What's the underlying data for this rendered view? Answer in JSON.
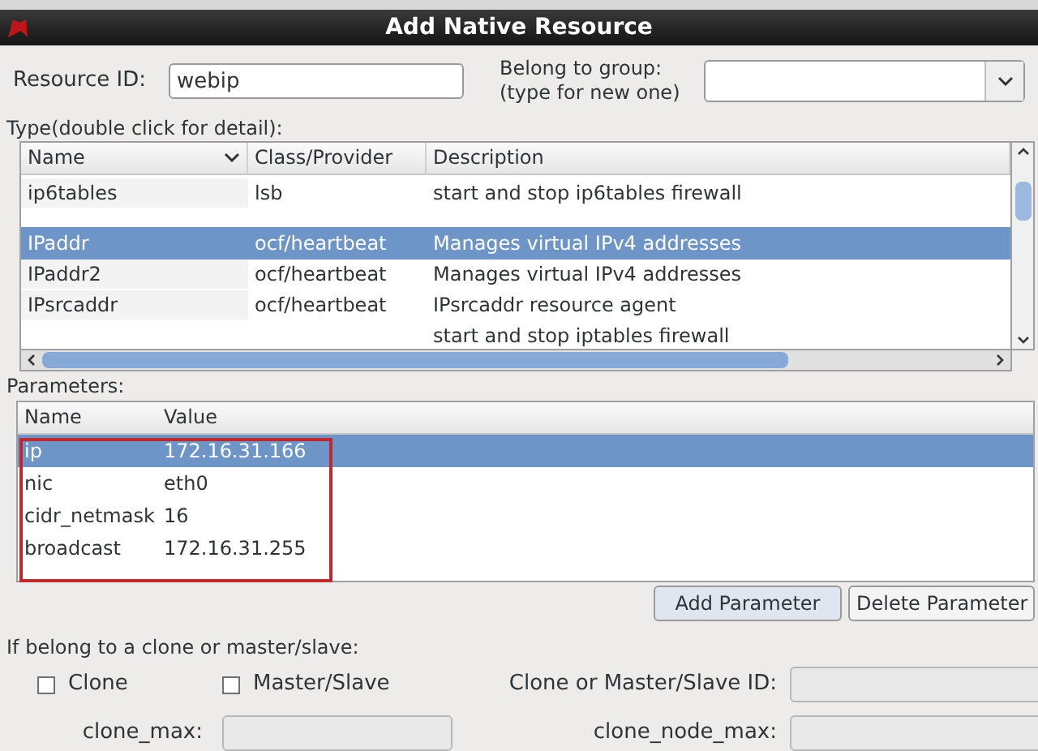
{
  "window": {
    "title": "Add Native Resource"
  },
  "resource_id": {
    "label": "Resource ID:",
    "value": "webip"
  },
  "group": {
    "label_lines": [
      "Belong to group:",
      "(type for new one)"
    ]
  },
  "type_section": {
    "label": "Type(double click for detail):",
    "columns": [
      "Name",
      "Class/Provider",
      "Description"
    ],
    "rows": [
      {
        "name": "ip6tables",
        "class": "lsb",
        "description": "start and stop ip6tables firewall",
        "selected": false
      },
      {
        "name": "IPaddr",
        "class": "ocf/heartbeat",
        "description": "Manages virtual IPv4 addresses",
        "selected": true
      },
      {
        "name": "IPaddr2",
        "class": "ocf/heartbeat",
        "description": "Manages virtual IPv4 addresses",
        "selected": false
      },
      {
        "name": "IPsrcaddr",
        "class": "ocf/heartbeat",
        "description": "IPsrcaddr resource agent",
        "selected": false
      },
      {
        "name": "",
        "class": "",
        "description": "start and stop iptables firewall",
        "selected": false
      }
    ]
  },
  "parameters": {
    "label": "Parameters:",
    "columns": [
      "Name",
      "Value"
    ],
    "rows": [
      {
        "name": "ip",
        "value": "172.16.31.166",
        "selected": true
      },
      {
        "name": "nic",
        "value": "eth0",
        "selected": false
      },
      {
        "name": "cidr_netmask",
        "value": "16",
        "selected": false
      },
      {
        "name": "broadcast",
        "value": "172.16.31.255",
        "selected": false
      }
    ],
    "buttons": [
      "Add Parameter",
      "Delete Parameter"
    ]
  },
  "clone_section": {
    "label": "If belong to a clone or master/slave:",
    "checkboxes": [
      {
        "label": "Clone",
        "checked": false
      },
      {
        "label": "Master/Slave",
        "checked": false
      }
    ],
    "id_label": "Clone or Master/Slave ID:",
    "clone_max_label": "clone_max:",
    "clone_node_max_label": "clone_node_max:"
  }
}
